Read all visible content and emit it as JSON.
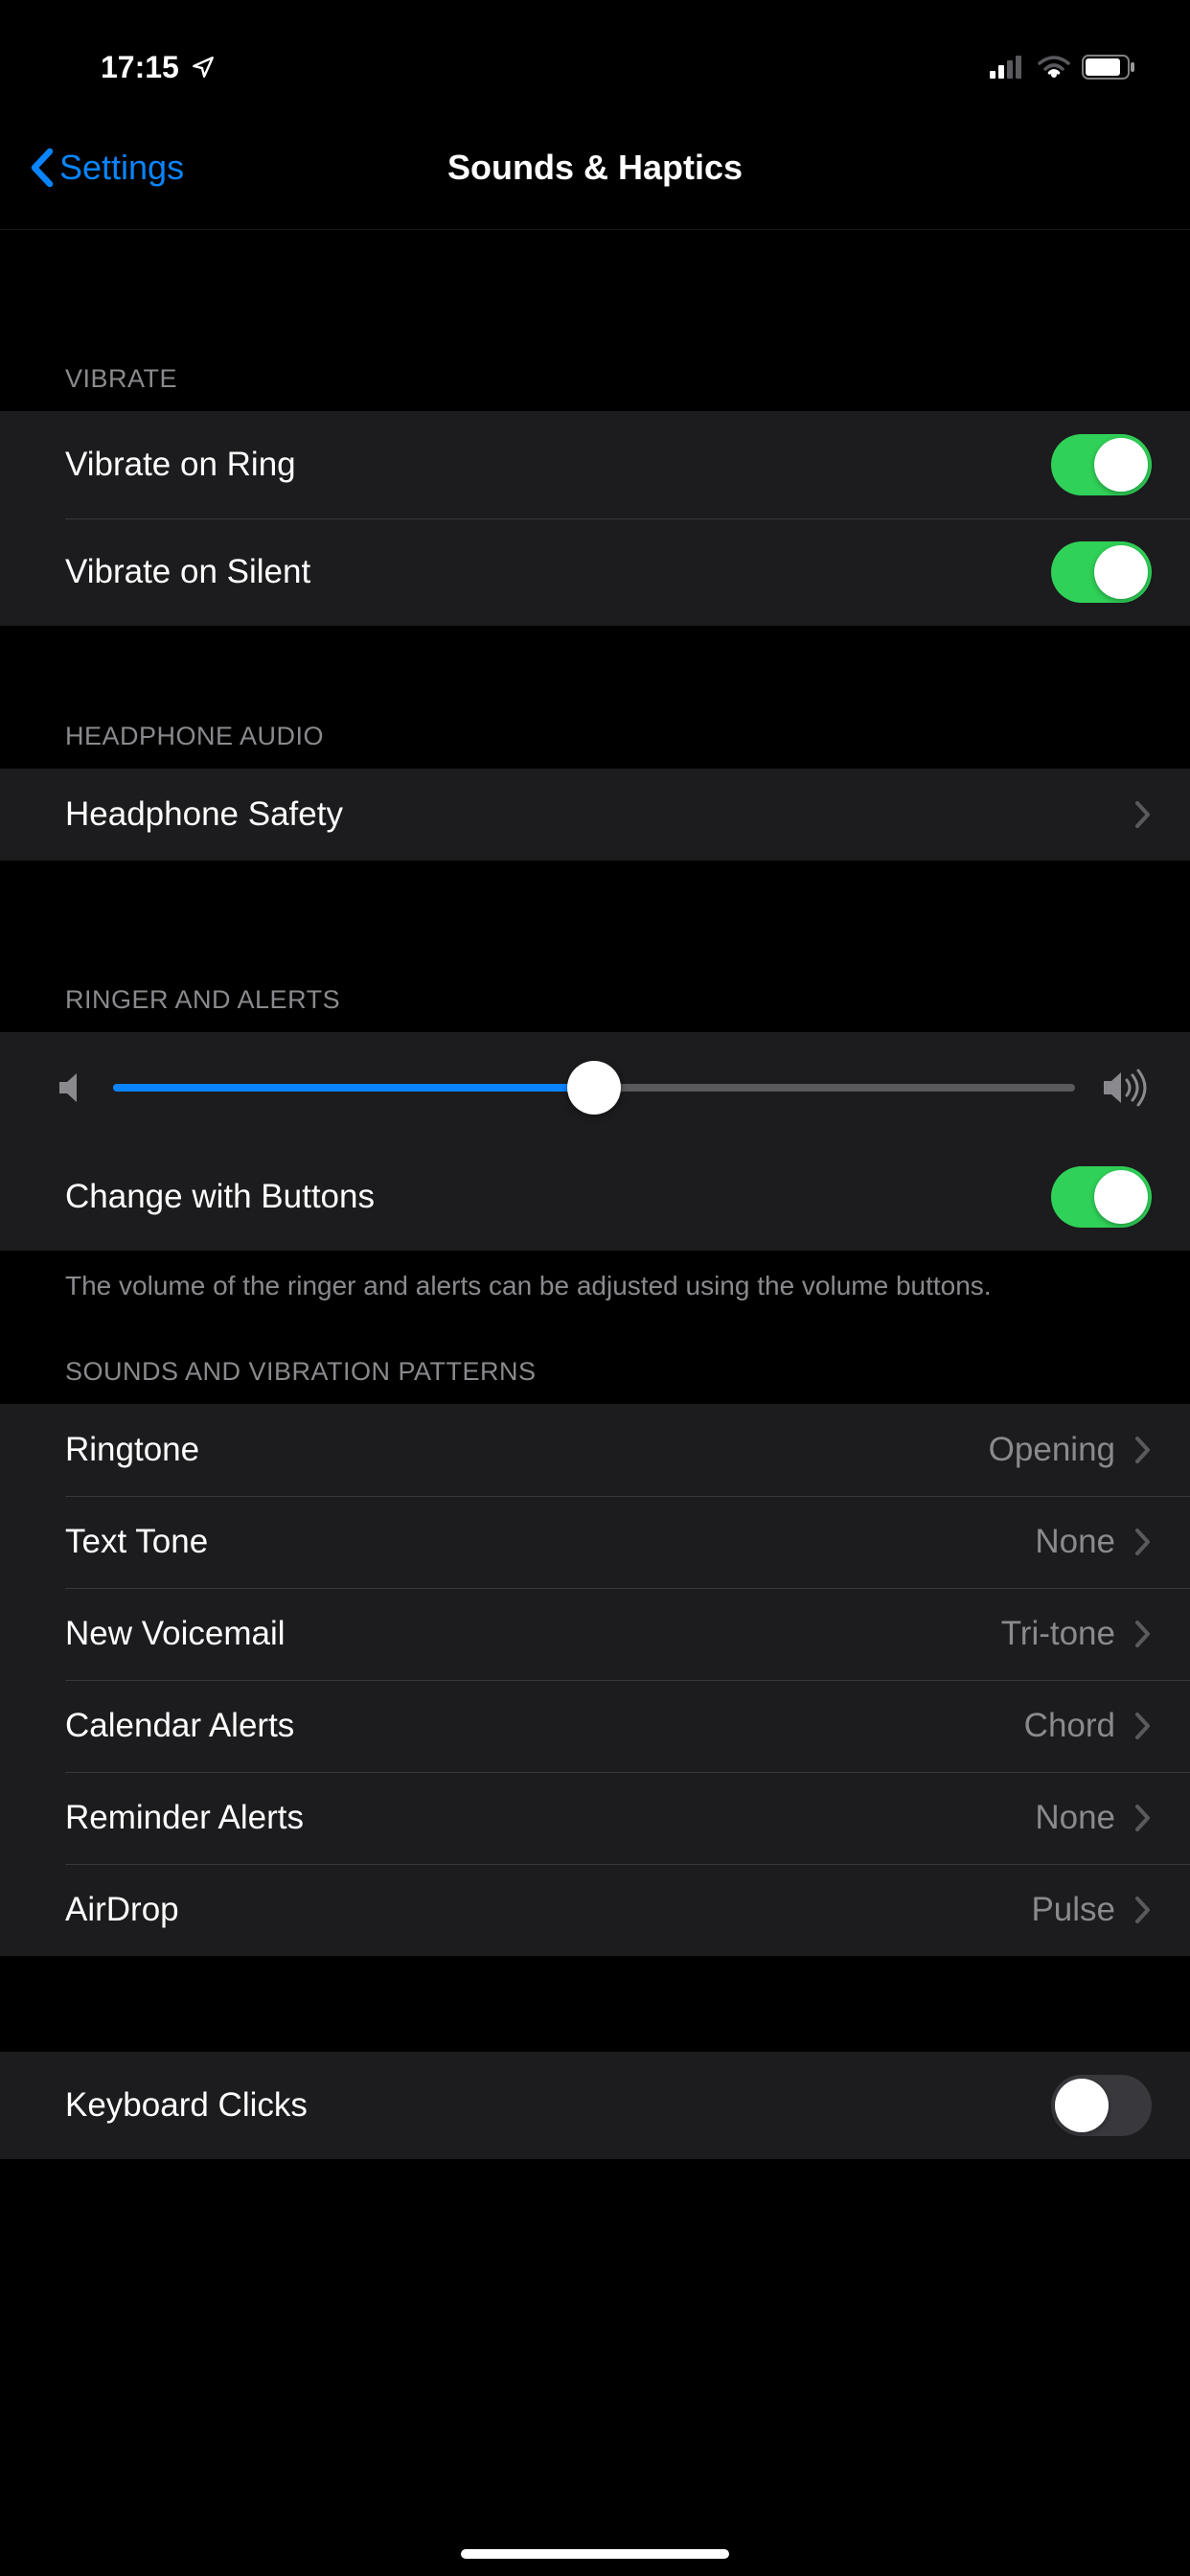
{
  "statusBar": {
    "time": "17:15"
  },
  "nav": {
    "backLabel": "Settings",
    "title": "Sounds & Haptics"
  },
  "sections": {
    "vibrate": {
      "header": "VIBRATE",
      "items": [
        {
          "label": "Vibrate on Ring",
          "on": true
        },
        {
          "label": "Vibrate on Silent",
          "on": true
        }
      ]
    },
    "headphoneAudio": {
      "header": "HEADPHONE AUDIO",
      "items": [
        {
          "label": "Headphone Safety"
        }
      ]
    },
    "ringerAlerts": {
      "header": "RINGER AND ALERTS",
      "sliderPercent": 50,
      "changeWithButtons": {
        "label": "Change with Buttons",
        "on": true
      },
      "footer": "The volume of the ringer and alerts can be adjusted using the volume buttons."
    },
    "soundsPatterns": {
      "header": "SOUNDS AND VIBRATION PATTERNS",
      "items": [
        {
          "label": "Ringtone",
          "value": "Opening"
        },
        {
          "label": "Text Tone",
          "value": "None"
        },
        {
          "label": "New Voicemail",
          "value": "Tri-tone"
        },
        {
          "label": "Calendar Alerts",
          "value": "Chord"
        },
        {
          "label": "Reminder Alerts",
          "value": "None"
        },
        {
          "label": "AirDrop",
          "value": "Pulse"
        }
      ]
    },
    "keyboard": {
      "items": [
        {
          "label": "Keyboard Clicks",
          "on": false
        }
      ]
    }
  }
}
